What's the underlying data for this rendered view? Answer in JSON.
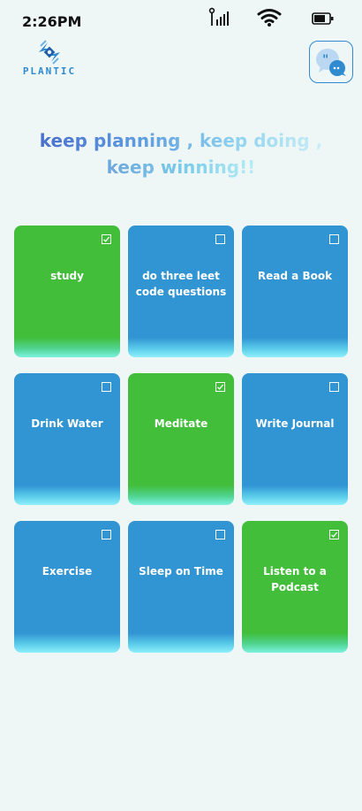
{
  "status_bar": {
    "time": "2:26PM",
    "signal_icon": "signal-icon",
    "wifi_icon": "wifi-icon",
    "battery_icon": "battery-icon"
  },
  "header": {
    "logo_text": "PLANTIC",
    "chat_icon": "chat-bubble-icon"
  },
  "tagline": {
    "line1": "keep planning , keep doing ,",
    "line2": "keep winning!!"
  },
  "colors": {
    "background": "#EEF7F6",
    "blue_card": "#3194D3",
    "green_card": "#42BE3B",
    "accent": "#2F8AD0"
  },
  "tasks": [
    {
      "label": "study",
      "checked": true
    },
    {
      "label": "do three leet code questions",
      "checked": false
    },
    {
      "label": "Read a Book",
      "checked": false
    },
    {
      "label": "Drink Water",
      "checked": false
    },
    {
      "label": "Meditate",
      "checked": true
    },
    {
      "label": "Write Journal",
      "checked": false
    },
    {
      "label": "Exercise",
      "checked": false
    },
    {
      "label": "Sleep on Time",
      "checked": false
    },
    {
      "label": "Listen to a Podcast",
      "checked": true
    }
  ]
}
